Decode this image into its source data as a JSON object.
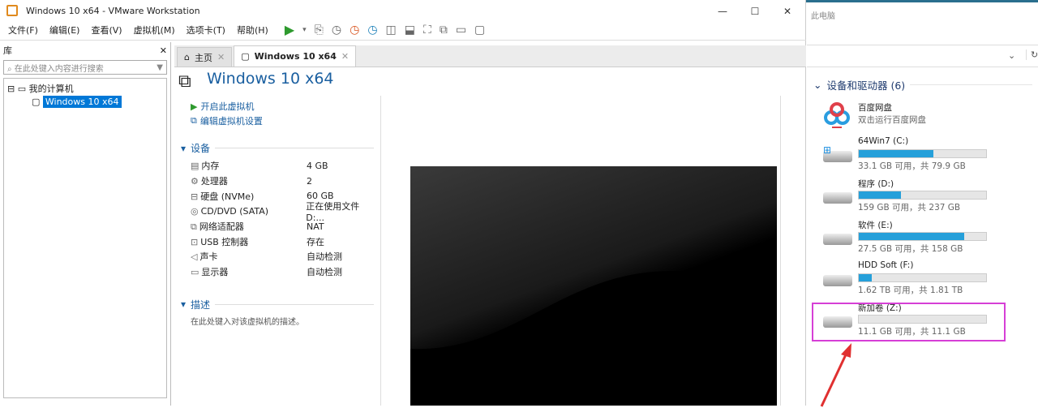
{
  "window": {
    "title": "Windows 10 x64 - VMware Workstation",
    "min": "—",
    "max": "☐",
    "close": "✕"
  },
  "menu": [
    "文件(F)",
    "编辑(E)",
    "查看(V)",
    "虚拟机(M)",
    "选项卡(T)",
    "帮助(H)"
  ],
  "library": {
    "title": "库",
    "close": "✕",
    "search_placeholder": "在此处键入内容进行搜索",
    "tree_root": "我的计算机",
    "tree_item": "Windows 10 x64"
  },
  "tabs": [
    {
      "label": "主页"
    },
    {
      "label": "Windows 10 x64"
    }
  ],
  "vm": {
    "title": "Windows 10 x64",
    "actions": [
      "开启此虚拟机",
      "编辑虚拟机设置"
    ],
    "devices_header": "设备",
    "devices": [
      [
        "内存",
        "4 GB"
      ],
      [
        "处理器",
        "2"
      ],
      [
        "硬盘 (NVMe)",
        "60 GB"
      ],
      [
        "CD/DVD (SATA)",
        "正在使用文件 D:..."
      ],
      [
        "网络适配器",
        "NAT"
      ],
      [
        "USB 控制器",
        "存在"
      ],
      [
        "声卡",
        "自动检测"
      ],
      [
        "显示器",
        "自动检测"
      ]
    ],
    "desc_header": "描述",
    "desc_placeholder": "在此处键入对该虚拟机的描述。"
  },
  "explorer": {
    "breadcrumb": "此电脑",
    "group": "设备和驱动器 (6)",
    "baidu": {
      "name": "百度网盘",
      "sub": "双击运行百度网盘"
    },
    "drives": [
      {
        "name": "64Win7  (C:)",
        "size": "33.1 GB 可用，共 79.9 GB",
        "used": 0.585
      },
      {
        "name": "程序 (D:)",
        "size": "159 GB 可用，共 237 GB",
        "used": 0.33
      },
      {
        "name": "软件 (E:)",
        "size": "27.5 GB 可用，共 158 GB",
        "used": 0.826
      },
      {
        "name": "HDD Soft (F:)",
        "size": "1.62 TB 可用，共 1.81 TB",
        "used": 0.105
      },
      {
        "name": "新加卷 (Z:)",
        "size": "11.1 GB 可用，共 11.1 GB",
        "used": 0.0
      }
    ],
    "highlight_color": "#d63fd6"
  }
}
